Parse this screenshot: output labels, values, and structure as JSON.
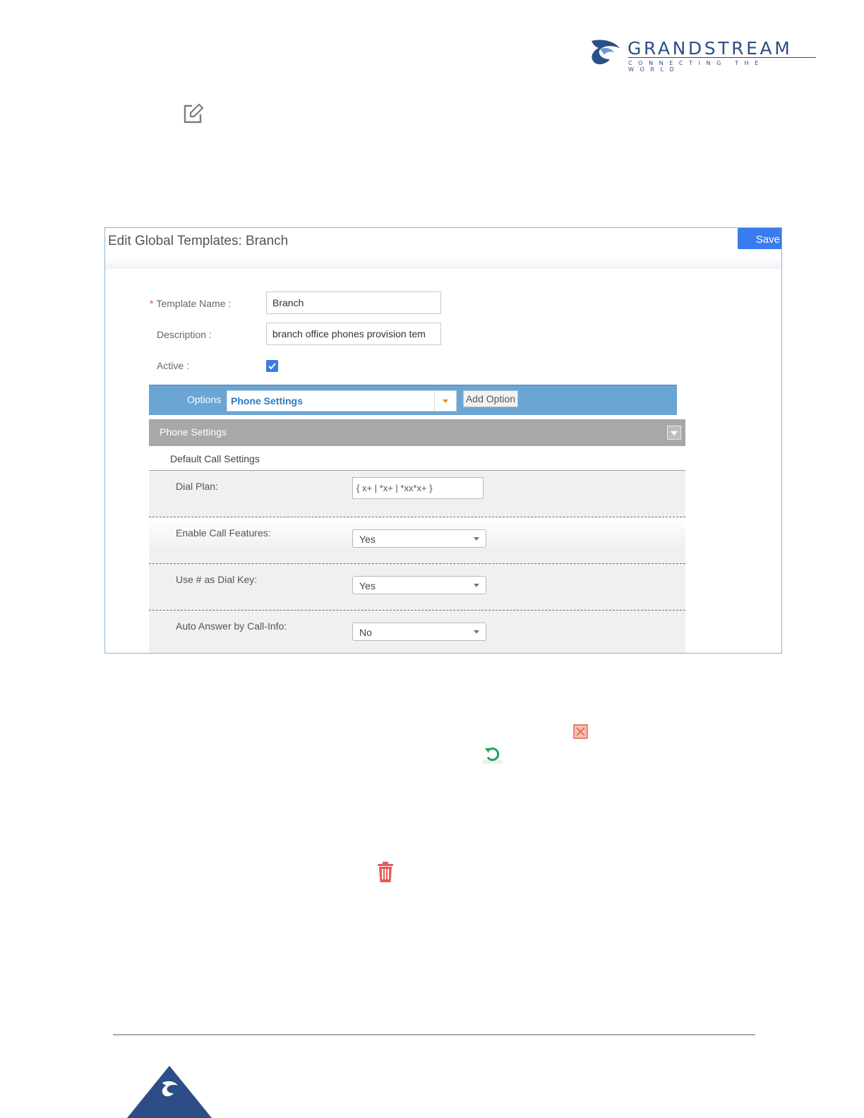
{
  "header": {
    "brand": "GRANDSTREAM",
    "tagline": "CONNECTING THE WORLD",
    "brand_color": "#2b4f86"
  },
  "icons": {
    "edit": "edit-icon",
    "close": "close-icon",
    "reset": "reset-icon",
    "delete": "trash-icon"
  },
  "dialog": {
    "title": "Edit Global Templates: Branch",
    "save_label": "Save",
    "fields": {
      "template_name_label": "Template Name",
      "template_name_value": "Branch",
      "description_label": "Description",
      "description_value": "branch office phones provision tem",
      "active_label": "Active",
      "active_checked": true
    },
    "options": {
      "label": "Options",
      "selected": "Phone Settings",
      "add_label": "Add Option"
    },
    "section": {
      "title": "Phone Settings",
      "subtitle": "Default Call Settings",
      "rows": [
        {
          "label": "Dial Plan:",
          "type": "text",
          "value": "{ x+ | *x+ | *xx*x+ }"
        },
        {
          "label": "Enable Call Features:",
          "type": "select",
          "value": "Yes"
        },
        {
          "label": "Use # as Dial Key:",
          "type": "select",
          "value": "Yes"
        },
        {
          "label": "Auto Answer by Call-Info:",
          "type": "select",
          "value": "No"
        }
      ]
    }
  }
}
